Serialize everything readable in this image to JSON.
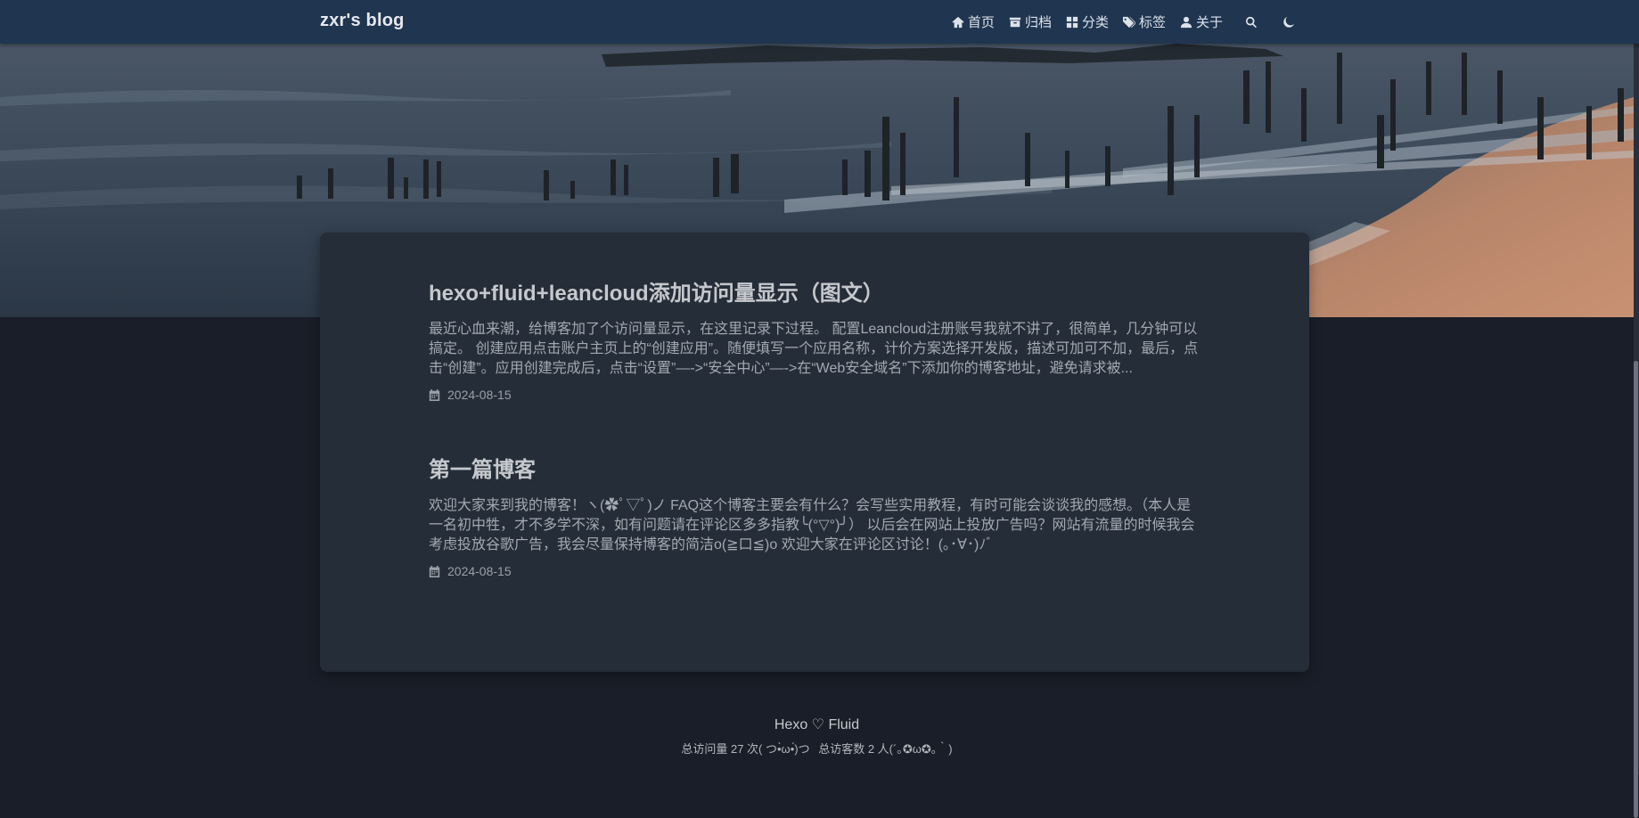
{
  "nav": {
    "brand": "zxr's blog",
    "items": [
      {
        "label": "首页",
        "icon": "home-icon"
      },
      {
        "label": "归档",
        "icon": "archive-icon"
      },
      {
        "label": "分类",
        "icon": "category-icon"
      },
      {
        "label": "标签",
        "icon": "tags-icon"
      },
      {
        "label": "关于",
        "icon": "user-icon"
      }
    ],
    "search_icon": "search-icon",
    "theme_icon": "moon-icon"
  },
  "posts": [
    {
      "title": "hexo+fluid+leancloud添加访问量显示（图文）",
      "excerpt": "最近心血来潮，给博客加了个访问量显示，在这里记录下过程。 配置Leancloud注册账号我就不讲了，很简单，几分钟可以搞定。 创建应用点击账户主页上的“创建应用”。随便填写一个应用名称，计价方案选择开发版，描述可加可不加，最后，点击“创建”。应用创建完成后，点击“设置”—->“安全中心”—->在“Web安全域名”下添加你的博客地址，避免请求被...",
      "date": "2024-08-15"
    },
    {
      "title": "第一篇博客",
      "excerpt": "欢迎大家来到我的博客！ヽ(✿ﾟ▽ﾟ)ノ FAQ这个博客主要会有什么？会写些实用教程，有时可能会谈谈我的感想。（本人是一名初中牲，才不多学不深，如有问题请在评论区多多指教╰(°▽°)╯） 以后会在网站上投放广告吗？网站有流量的时候我会考虑投放谷歌广告，我会尽量保持博客的简洁o(≧口≦)o 欢迎大家在评论区讨论！(｡･∀･)ﾉﾞ",
      "date": "2024-08-15"
    }
  ],
  "footer": {
    "powered": "Hexo ♡ Fluid",
    "pv": "总访问量 27 次( つ•̀ω•́)つ",
    "uv": "总访客数 2 人(´｡✪ω✪｡｀)"
  },
  "colors": {
    "navbar": "#1f3550",
    "background": "#1a1e28",
    "card": "#252d38"
  }
}
